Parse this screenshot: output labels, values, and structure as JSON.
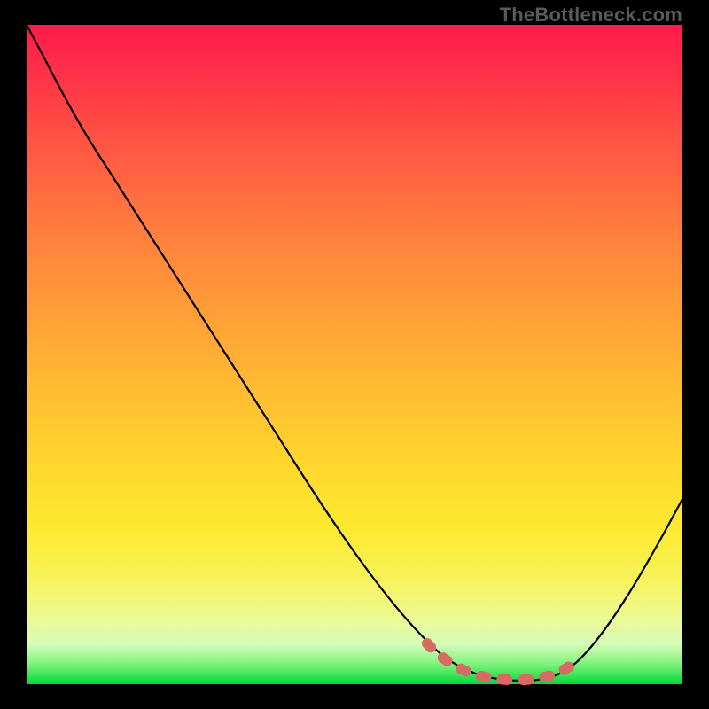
{
  "attribution": "TheBottleneck.com",
  "chart_data": {
    "type": "line",
    "title": "",
    "xlabel": "",
    "ylabel": "",
    "xlim": [
      0,
      100
    ],
    "ylim": [
      0,
      100
    ],
    "series": [
      {
        "name": "bottleneck-curve",
        "x": [
          0,
          8,
          16,
          24,
          32,
          40,
          48,
          56,
          62,
          66,
          70,
          74,
          78,
          82,
          88,
          94,
          100
        ],
        "values": [
          100,
          90,
          79,
          67,
          56,
          45,
          34,
          22,
          13,
          7,
          3,
          1,
          1,
          2,
          8,
          17,
          28
        ]
      },
      {
        "name": "minimum-band",
        "x": [
          62,
          66,
          70,
          74,
          78,
          82
        ],
        "values": [
          5,
          3,
          2,
          2,
          2,
          4
        ]
      }
    ],
    "annotations": []
  },
  "colors": {
    "curve": "#000000",
    "minimum_band": "#d86a64",
    "background_top": "#ff1a4d",
    "background_bottom": "#00d936",
    "frame": "#000000"
  }
}
